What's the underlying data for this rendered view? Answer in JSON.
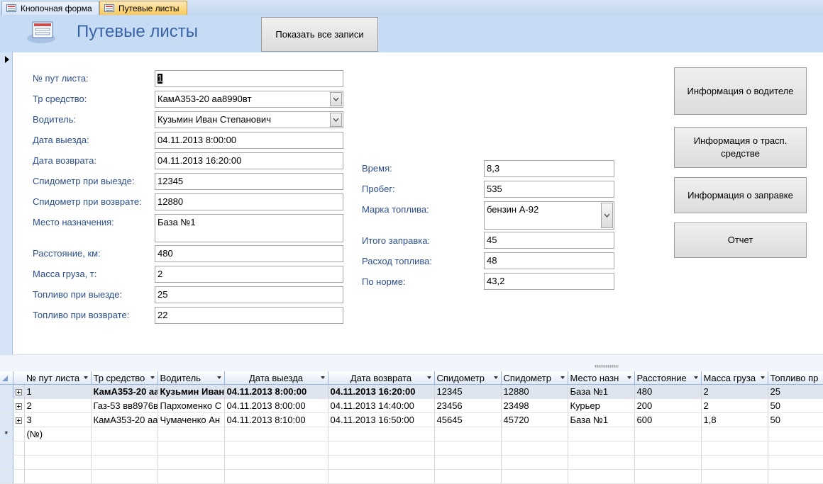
{
  "tabs": [
    {
      "label": "Кнопочная форма",
      "active": false,
      "icon": "form-icon"
    },
    {
      "label": "Путевые листы",
      "active": true,
      "icon": "form-icon"
    }
  ],
  "header": {
    "title": "Путевые листы",
    "show_all_label": "Показать все записи"
  },
  "form_left": {
    "num_label": "№ пут листа:",
    "num_value": "1",
    "vehicle_label": "Тр средство:",
    "vehicle_value": "КамА353-20 аа8990вт",
    "driver_label": "Водитель:",
    "driver_value": "Кузьмин Иван Степанович",
    "depart_label": "Дата выезда:",
    "depart_value": "04.11.2013 8:00:00",
    "return_label": "Дата возврата:",
    "return_value": "04.11.2013 16:20:00",
    "odo_depart_label": "Спидометр при выезде:",
    "odo_depart_value": "12345",
    "odo_return_label": "Спидометр при возврате:",
    "odo_return_value": "12880",
    "dest_label": "Место назначения:",
    "dest_value": "База №1",
    "distance_label": "Расстояние, км:",
    "distance_value": "480",
    "cargo_label": "Масса груза, т:",
    "cargo_value": "2",
    "fuel_depart_label": "Топливо при выезде:",
    "fuel_depart_value": "25",
    "fuel_return_label": "Топливо при возврате:",
    "fuel_return_value": "22"
  },
  "form_mid": {
    "time_label": "Время:",
    "time_value": "8,3",
    "mileage_label": "Пробег:",
    "mileage_value": "535",
    "fuel_brand_label": "Марка топлива:",
    "fuel_brand_value": "бензин А-92",
    "refuel_label": "Итого заправка:",
    "refuel_value": "45",
    "consumption_label": "Расход топлива:",
    "consumption_value": "48",
    "norm_label": "По норме:",
    "norm_value": "43,2"
  },
  "buttons": {
    "driver_info": "Информация о водителе",
    "vehicle_info": "Информация о трасп. средстве",
    "refuel_info": "Информация о заправке",
    "report": "Отчет"
  },
  "grid": {
    "columns": [
      "№ пут листа",
      "Тр средство",
      "Водитель",
      "Дата выезда",
      "Дата возврата",
      "Спидометр",
      "Спидометр",
      "Место назн",
      "Расстояние",
      "Масса груза",
      "Топливо пр"
    ],
    "rows": [
      [
        "1",
        "КамА353-20 аа",
        "Кузьмин Иван",
        "04.11.2013 8:00:00",
        "04.11.2013 16:20:00",
        "12345",
        "12880",
        "База №1",
        "480",
        "2",
        "25"
      ],
      [
        "2",
        "Газ-53 вв8976в",
        "Пархоменко С",
        "04.11.2013 8:00:00",
        "04.11.2013 14:40:00",
        "23456",
        "23498",
        "Курьер",
        "200",
        "2",
        "50"
      ],
      [
        "3",
        "КамА353-20 аа",
        "Чумаченко Ан",
        "04.11.2013 8:10:00",
        "04.11.2013 16:50:00",
        "45645",
        "45720",
        "База №1",
        "600",
        "1,8",
        "50"
      ]
    ],
    "new_row_marker": "*",
    "new_row_placeholder": "(№)"
  }
}
